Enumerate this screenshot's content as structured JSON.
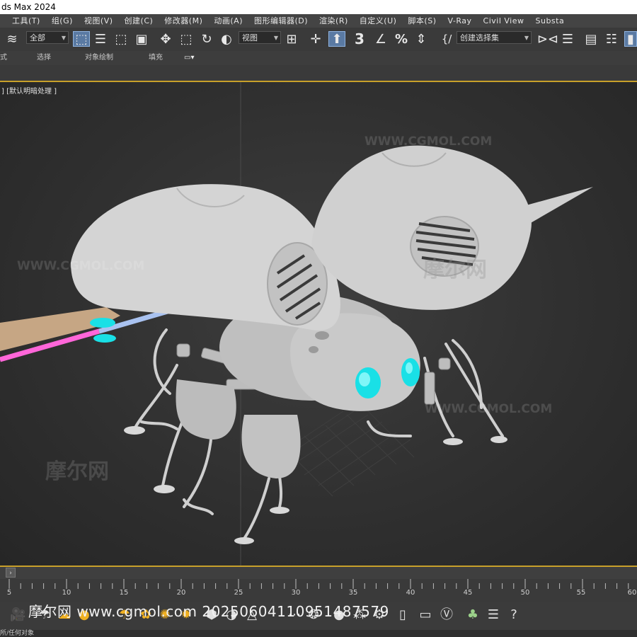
{
  "window": {
    "title": "ds Max 2024"
  },
  "menu": [
    "工具(T)",
    "组(G)",
    "视图(V)",
    "创建(C)",
    "修改器(M)",
    "动画(A)",
    "图形编辑器(D)",
    "渲染(R)",
    "自定义(U)",
    "脚本(S)",
    "V-Ray",
    "Civil View",
    "Substa"
  ],
  "toolbar": {
    "selection_filter": "全部",
    "reference_coord": "视图",
    "named_selection": "创建选择集"
  },
  "ribbon": {
    "tabs": [
      "式",
      "选择",
      "对象绘制",
      "填充"
    ]
  },
  "viewport": {
    "label": "] [默认明暗处理 ]",
    "watermarks": [
      "WWW.CGMOL.COM",
      "摩尔网",
      "WWW.CGMOL.COM"
    ]
  },
  "timeline": {
    "ticks": [
      "5",
      "10",
      "15",
      "20",
      "25",
      "30",
      "35",
      "40",
      "45",
      "50",
      "55",
      "60"
    ]
  },
  "overlay": {
    "url_text": "摩尔网 www.cgmol.com 20250604110951487579"
  },
  "status": {
    "text": "所/任何对象"
  },
  "colors": {
    "accent": "#c8a02a",
    "eye": "#19e0e6",
    "model": "#c9c9c9"
  }
}
